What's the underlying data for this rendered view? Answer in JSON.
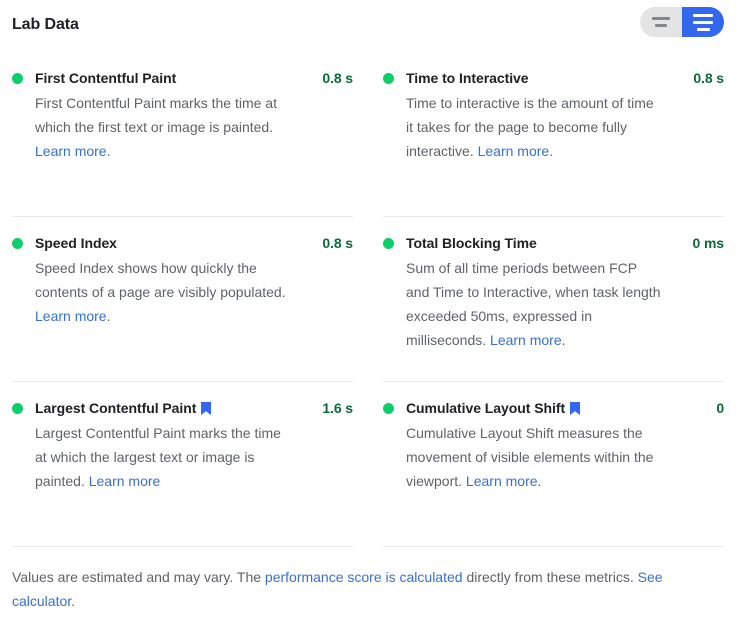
{
  "header": {
    "title": "Lab Data",
    "view_toggle": {
      "compact_view_label": "compact-view",
      "expanded_view_label": "expanded-view",
      "active": "expanded-view",
      "active_color": "#3367f0",
      "inactive_color": "#e4e4e4"
    }
  },
  "colors": {
    "bullet_good": "#0cce6b",
    "value_good": "#0a6c39",
    "link": "#3670d4",
    "vitals_badge": "#3367f0",
    "divider": "#e8eaed",
    "description": "#5f6368",
    "title": "#202124"
  },
  "metrics": [
    {
      "title": "First Contentful Paint",
      "description_before": "First Contentful Paint marks the time at which the first text or image is painted. ",
      "link_text": "Learn more",
      "description_after": ".",
      "value": "0.8 s",
      "status": "good",
      "core_web_vital": false
    },
    {
      "title": "Time to Interactive",
      "description_before": "Time to interactive is the amount of time it takes for the page to become fully interactive. ",
      "link_text": "Learn more",
      "description_after": ".",
      "value": "0.8 s",
      "status": "good",
      "core_web_vital": false
    },
    {
      "title": "Speed Index",
      "description_before": "Speed Index shows how quickly the contents of a page are visibly populated. ",
      "link_text": "Learn more",
      "description_after": ".",
      "value": "0.8 s",
      "status": "good",
      "core_web_vital": false
    },
    {
      "title": "Total Blocking Time",
      "description_before": "Sum of all time periods between FCP and Time to Interactive, when task length exceeded 50ms, expressed in milliseconds. ",
      "link_text": "Learn more",
      "description_after": ".",
      "value": "0 ms",
      "status": "good",
      "core_web_vital": false
    },
    {
      "title": "Largest Contentful Paint",
      "description_before": "Largest Contentful Paint marks the time at which the largest text or image is painted. ",
      "link_text": "Learn more",
      "description_after": "",
      "value": "1.6 s",
      "status": "good",
      "core_web_vital": true
    },
    {
      "title": "Cumulative Layout Shift",
      "description_before": "Cumulative Layout Shift measures the movement of visible elements within the viewport. ",
      "link_text": "Learn more",
      "description_after": ".",
      "value": "0",
      "status": "good",
      "core_web_vital": true
    }
  ],
  "footer": {
    "text_1": "Values are estimated and may vary. The ",
    "link_1": "performance score is calculated",
    "text_2": " directly from these metrics. ",
    "link_2": "See calculator",
    "text_3": "."
  }
}
